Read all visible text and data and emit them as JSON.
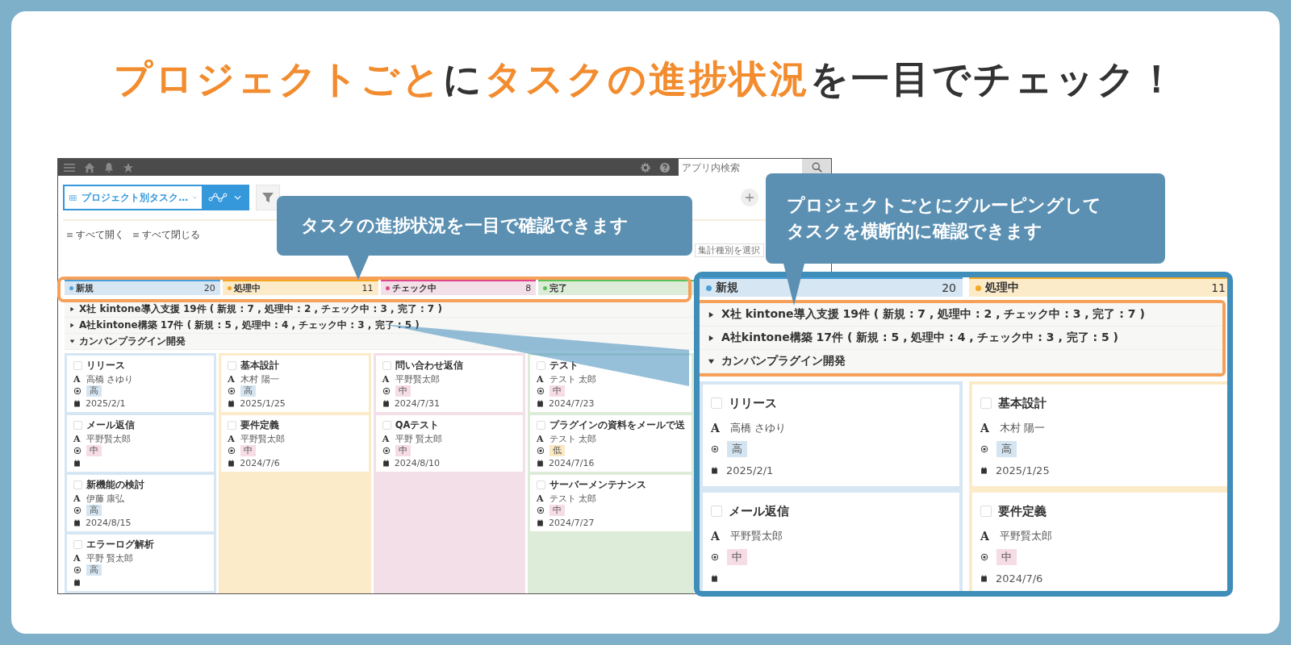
{
  "headline": [
    {
      "text": "プロジェクトごと",
      "accent": true
    },
    {
      "text": "に",
      "accent": false
    },
    {
      "text": "タスクの進捗状況",
      "accent": true
    },
    {
      "text": "を一目でチェック！",
      "accent": false
    }
  ],
  "app": {
    "search_placeholder": "アプリ内検索",
    "view_name": "プロジェクト別タスク…",
    "expand_all": "すべて開く",
    "collapse_all": "すべて閉じる",
    "aggregate_placeholder": "集計種別を選択",
    "columns": [
      {
        "name": "新規",
        "count": "20",
        "color": "#4a9fd8",
        "cards": [
          {
            "title": "リリース",
            "checked": false,
            "assignee_icon": "A",
            "assignee": "高橋 さゆり",
            "priority": {
              "label": "高",
              "color": "#d4e5f1"
            },
            "date": "2025/2/1"
          },
          {
            "title": "メール返信",
            "checked": false,
            "assignee_icon": "A",
            "assignee": "平野賢太郎",
            "priority": {
              "label": "中",
              "color": "#f6dce5"
            }
          },
          {
            "title": "新機能の検討",
            "checked": false,
            "assignee_icon": "A",
            "assignee": "伊藤 康弘",
            "priority": {
              "label": "高",
              "color": "#d4e5f1"
            },
            "date": "2024/8/15"
          },
          {
            "title": "エラーログ解析",
            "checked": false,
            "assignee_icon": "A",
            "assignee": "平野 賢太郎",
            "priority": {
              "label": "高",
              "color": "#d4e5f1"
            }
          }
        ]
      },
      {
        "name": "処理中",
        "count": "11",
        "color": "#f5a623",
        "cards": [
          {
            "title": "基本設計",
            "checked": false,
            "assignee_icon": "A",
            "assignee": "木村 陽一",
            "priority": {
              "label": "高",
              "color": "#d4e5f1"
            },
            "date": "2025/1/25"
          },
          {
            "title": "要件定義",
            "checked": false,
            "assignee_icon": "A",
            "assignee": "平野賢太郎",
            "priority": {
              "label": "中",
              "color": "#f6dce5"
            },
            "date": "2024/7/6"
          }
        ]
      },
      {
        "name": "チェック中",
        "count": "8",
        "color": "#e0468a",
        "cards": [
          {
            "title": "問い合わせ返信",
            "checked": false,
            "assignee_icon": "A",
            "assignee": "平野賢太郎",
            "priority": {
              "label": "中",
              "color": "#f6dce5"
            },
            "date": "2024/7/31"
          },
          {
            "title": "QAテスト",
            "checked": false,
            "assignee_icon": "A",
            "assignee": "平野 賢太郎",
            "priority": {
              "label": "中",
              "color": "#f6dce5"
            },
            "date": "2024/8/10"
          }
        ]
      },
      {
        "name": "完了",
        "color": "#5cc25c",
        "cards": [
          {
            "title": "テスト",
            "checked": false,
            "assignee_icon": "A",
            "assignee": "テスト 太郎",
            "priority": {
              "label": "中",
              "color": "#f6dce5"
            },
            "date": "2024/7/23"
          },
          {
            "title": "プラグインの資料をメールで送",
            "checked": false,
            "assignee_icon": "A",
            "assignee": "テスト 太郎",
            "priority": {
              "label": "低",
              "color": "#fbe9c2"
            },
            "date": "2024/7/16"
          },
          {
            "title": "サーバーメンテナンス",
            "checked": false,
            "assignee_icon": "A",
            "assignee": "テスト 太郎",
            "priority": {
              "label": "中",
              "color": "#f6dce5"
            },
            "date": "2024/7/27"
          }
        ]
      }
    ],
    "groups": [
      {
        "label": "X社 kintone導入支援  19件 ( 新規 : 7 , 処理中 : 2 , チェック中 : 3 , 完了 : 7 )",
        "expanded": false
      },
      {
        "label": "A社kintone構築  17件 ( 新規 : 5 , 処理中 : 4 , チェック中 : 3 , 完了 : 5 )",
        "expanded": false
      },
      {
        "label": "カンバンプラグイン開発",
        "expanded": true
      }
    ]
  },
  "callouts": [
    {
      "lines": [
        "タスクの進捗状況を一目で確認できます"
      ]
    },
    {
      "lines": [
        "プロジェクトごとにグルーピングして",
        "タスクを横断的に確認できます"
      ]
    }
  ],
  "zoom": {
    "columns": [
      {
        "name": "新規",
        "count": "20",
        "color": "#4a9fd8",
        "cards": [
          {
            "title": "リリース",
            "checked": false,
            "assignee_icon": "A",
            "assignee": "高橋 さゆり",
            "priority": {
              "label": "高",
              "color": "#d4e5f1"
            },
            "date": "2025/2/1"
          },
          {
            "title": "メール返信",
            "checked": false,
            "assignee_icon": "A",
            "assignee": "平野賢太郎",
            "priority": {
              "label": "中",
              "color": "#f6dce5"
            }
          }
        ]
      },
      {
        "name": "処理中",
        "count": "11",
        "color": "#f5a623",
        "cards": [
          {
            "title": "基本設計",
            "checked": false,
            "assignee_icon": "A",
            "assignee": "木村 陽一",
            "priority": {
              "label": "高",
              "color": "#d4e5f1"
            },
            "date": "2025/1/25"
          },
          {
            "title": "要件定義",
            "checked": false,
            "assignee_icon": "A",
            "assignee": "平野賢太郎",
            "priority": {
              "label": "中",
              "color": "#f6dce5"
            },
            "date": "2024/7/6"
          }
        ]
      }
    ],
    "groups": [
      {
        "label": "X社 kintone導入支援  19件 ( 新規 : 7 , 処理中 : 2 , チェック中 : 3 , 完了 : 7 )",
        "expanded": false
      },
      {
        "label": "A社kintone構築  17件 ( 新規 : 5 , 処理中 : 4 , チェック中 : 3 , 完了 : 5 )",
        "expanded": false
      },
      {
        "label": "カンバンプラグイン開発",
        "expanded": true
      }
    ]
  }
}
